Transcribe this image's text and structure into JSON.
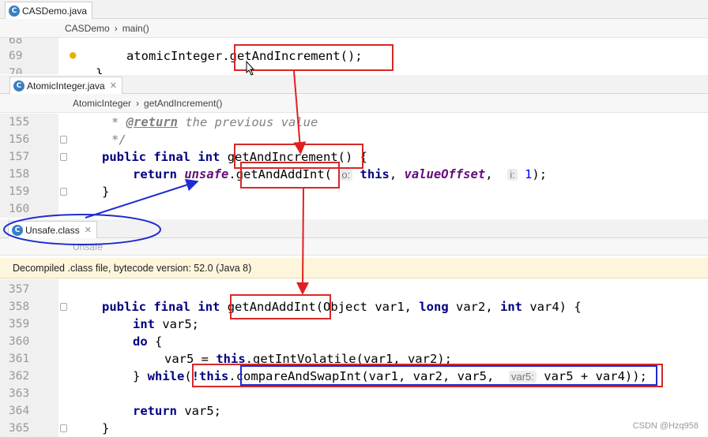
{
  "pane1": {
    "tab": "CASDemo.java",
    "breadcrumb": [
      "CASDemo",
      "main()"
    ],
    "lines": [
      {
        "n": "68",
        "text": ""
      },
      {
        "n": "69",
        "text": "atomicInteger.getAndIncrement();"
      },
      {
        "n": "70",
        "text": "}"
      }
    ]
  },
  "pane2": {
    "tab": "AtomicInteger.java",
    "breadcrumb": [
      "AtomicInteger",
      "getAndIncrement()"
    ],
    "lines": [
      {
        "n": "155",
        "pre": "* ",
        "tag": "@return",
        "post": " the previous value"
      },
      {
        "n": "156",
        "text": "*/"
      },
      {
        "n": "157",
        "text": "getAndIncrement() {"
      },
      {
        "n": "158",
        "text": ""
      },
      {
        "n": "159",
        "text": "}"
      },
      {
        "n": "160",
        "text": ""
      }
    ],
    "kw": {
      "public": "public",
      "final": "final",
      "int": "int",
      "return": "return",
      "this": "this"
    },
    "unsafe": "unsafe",
    "method": "getAndAddInt",
    "hint_o": "o:",
    "valueOffset": "valueOffset",
    "hint_i": "i:",
    "one": "1"
  },
  "pane3": {
    "tab": "Unsafe.class",
    "breadcrumb": [
      "Unsafe"
    ],
    "banner": "Decompiled .class file, bytecode version: 52.0 (Java 8)",
    "lines": [
      {
        "n": "357"
      },
      {
        "n": "358"
      },
      {
        "n": "359"
      },
      {
        "n": "360"
      },
      {
        "n": "361"
      },
      {
        "n": "362"
      },
      {
        "n": "363"
      },
      {
        "n": "364"
      },
      {
        "n": "365"
      }
    ],
    "l358_sig": "(Object var1, ",
    "l358_long": "long",
    "l358_rest": " var2, ",
    "l358_int2": "int",
    "l358_end": " var4) {",
    "l359": "var5;",
    "l360": "do",
    "l361_pre": "var5 = ",
    "l361_call": ".getIntVolatile(var1, var2);",
    "l362_while": "while",
    "l362_not": "!",
    "l362_cas": "compareAndSwapInt(var1, var2, var5,",
    "hint_var5": "var5:",
    "l362_tail": "var5 + var4)",
    "l362_end": ");",
    "l364": "var5;",
    "l365": "}"
  },
  "watermark": "CSDN @Hzq958"
}
